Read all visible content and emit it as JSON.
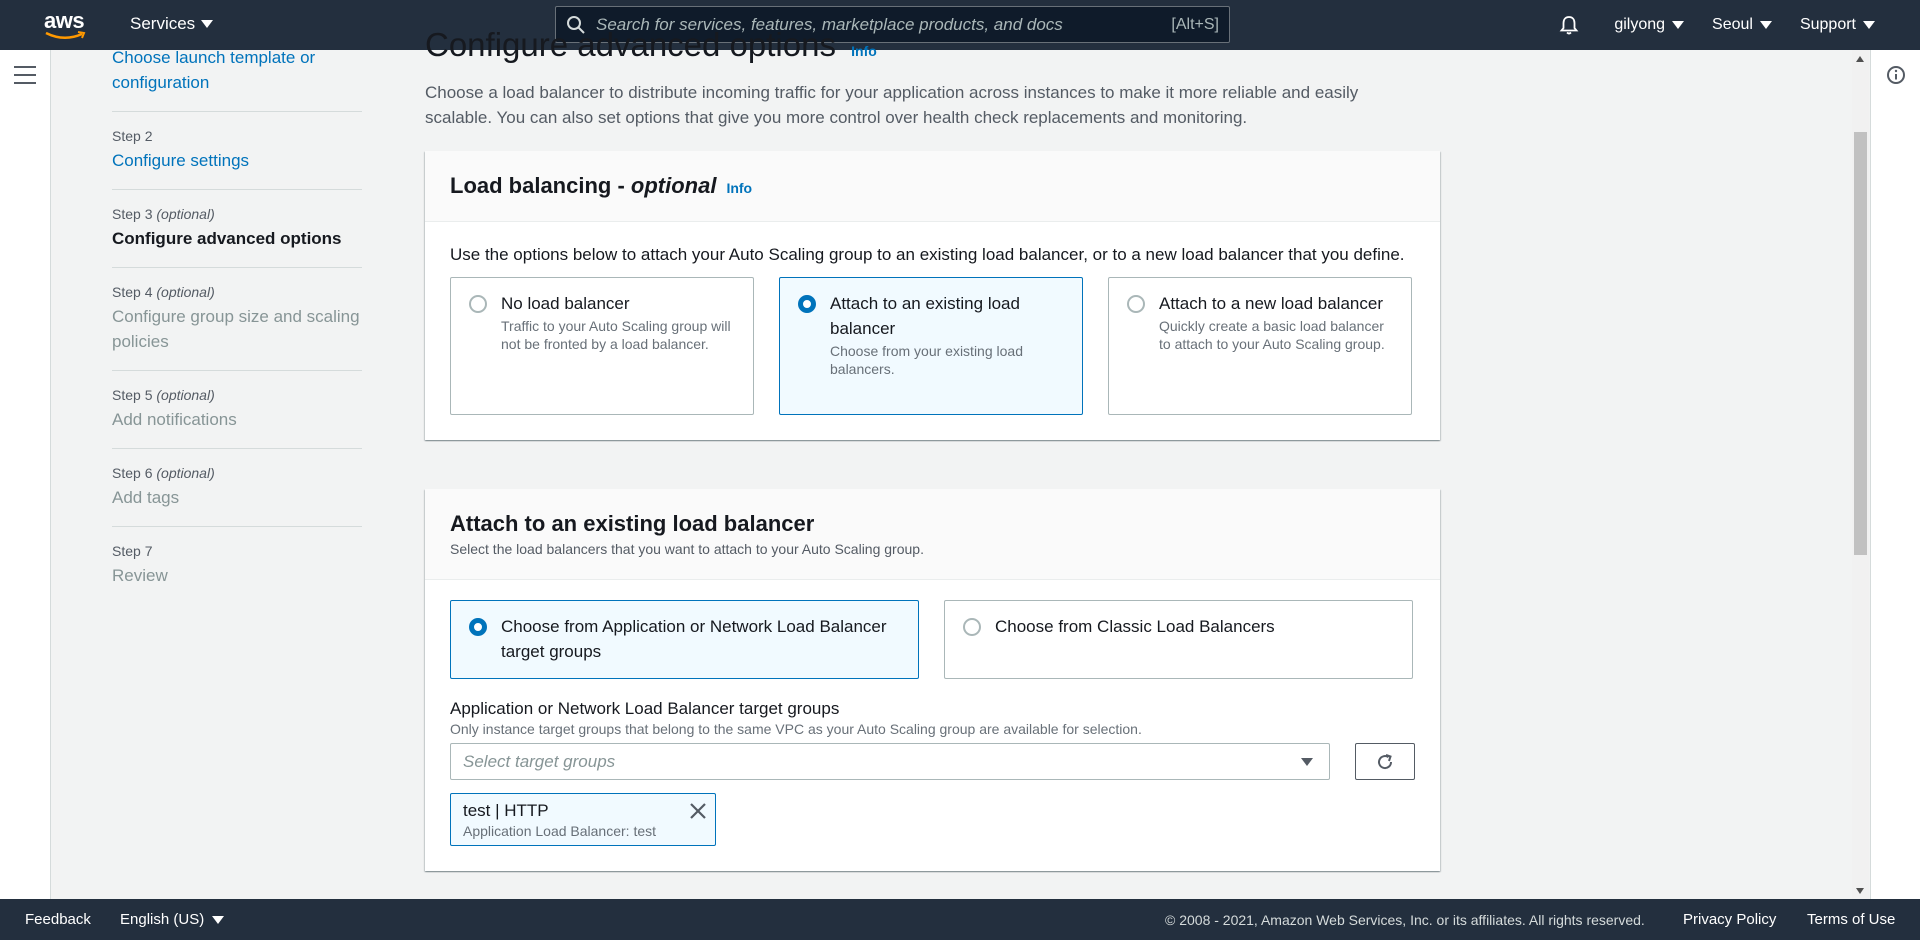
{
  "topnav": {
    "logo": "aws",
    "services_label": "Services",
    "search_placeholder": "Search for services, features, marketplace products, and docs",
    "search_shortcut": "[Alt+S]",
    "user_label": "gilyong",
    "region_label": "Seoul",
    "support_label": "Support"
  },
  "steps": [
    {
      "label": "",
      "label_optional": "",
      "title": "Choose launch template or configuration",
      "state": "link"
    },
    {
      "label": "Step 2",
      "label_optional": "",
      "title": "Configure settings",
      "state": "link"
    },
    {
      "label": "Step 3",
      "label_optional": "(optional)",
      "title": "Configure advanced options",
      "state": "current"
    },
    {
      "label": "Step 4",
      "label_optional": "(optional)",
      "title": "Configure group size and scaling policies",
      "state": "disabled"
    },
    {
      "label": "Step 5",
      "label_optional": "(optional)",
      "title": "Add notifications",
      "state": "disabled"
    },
    {
      "label": "Step 6",
      "label_optional": "(optional)",
      "title": "Add tags",
      "state": "disabled"
    },
    {
      "label": "Step 7",
      "label_optional": "",
      "title": "Review",
      "state": "disabled"
    }
  ],
  "main": {
    "title": "Configure advanced options",
    "title_info": "Info",
    "description": "Choose a load balancer to distribute incoming traffic for your application across instances to make it more reliable and easily scalable. You can also set options that give you more control over health check replacements and monitoring."
  },
  "load_balancing": {
    "title": "Load balancing - ",
    "title_optional": "optional",
    "info": "Info",
    "lead": "Use the options below to attach your Auto Scaling group to an existing load balancer, or to a new load balancer that you define.",
    "options": [
      {
        "title": "No load balancer",
        "desc": "Traffic to your Auto Scaling group will not be fronted by a load balancer.",
        "selected": false
      },
      {
        "title": "Attach to an existing load balancer",
        "desc": "Choose from your existing load balancers.",
        "selected": true
      },
      {
        "title": "Attach to a new load balancer",
        "desc": "Quickly create a basic load balancer to attach to your Auto Scaling group.",
        "selected": false
      }
    ]
  },
  "attach_existing": {
    "title": "Attach to an existing load balancer",
    "subtitle": "Select the load balancers that you want to attach to your Auto Scaling group.",
    "options": [
      {
        "title": "Choose from Application or Network Load Balancer target groups",
        "selected": true
      },
      {
        "title": "Choose from Classic Load Balancers",
        "selected": false
      }
    ],
    "field_label": "Application or Network Load Balancer target groups",
    "field_hint": "Only instance target groups that belong to the same VPC as your Auto Scaling group are available for selection.",
    "select_placeholder": "Select target groups",
    "token_title": "test | HTTP",
    "token_sub": "Application Load Balancer: test"
  },
  "footer": {
    "feedback": "Feedback",
    "language": "English (US)",
    "copyright": "© 2008 - 2021, Amazon Web Services, Inc. or its affiliates. All rights reserved.",
    "privacy": "Privacy Policy",
    "terms": "Terms of Use"
  },
  "colors": {
    "nav_bg": "#232f3e",
    "link": "#0073bb",
    "selected_bg": "#f1faff"
  }
}
